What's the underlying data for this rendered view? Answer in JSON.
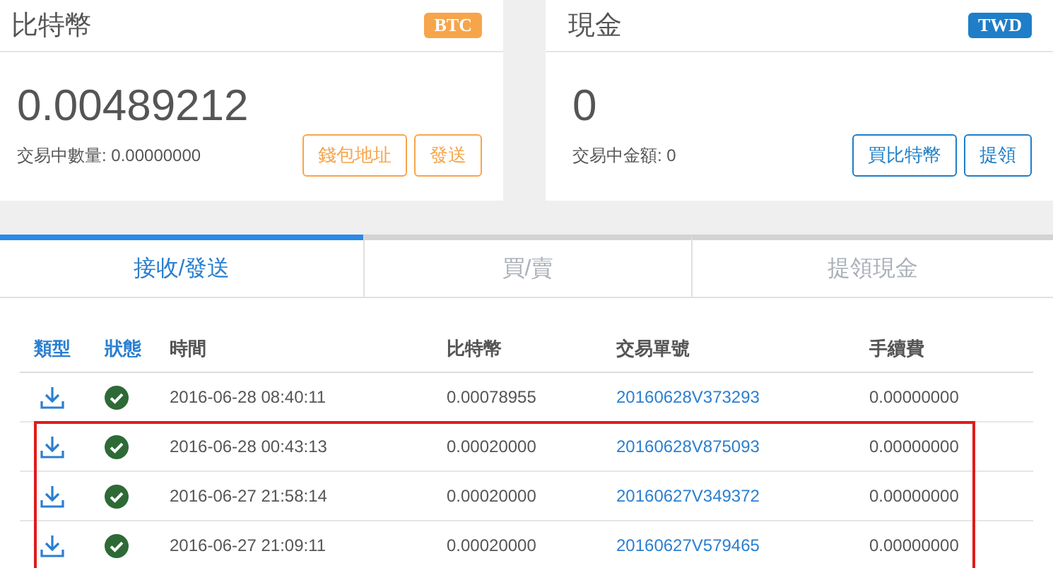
{
  "cards": [
    {
      "title": "比特幣",
      "badge": "BTC",
      "color": "#f7a54a",
      "amount": "0.00489212",
      "pending_label": "交易中數量:",
      "pending_value": "0.00000000",
      "buttons": [
        "錢包地址",
        "發送"
      ]
    },
    {
      "title": "現金",
      "badge": "TWD",
      "color": "#1f7ec7",
      "amount": "0",
      "pending_label": "交易中金額:",
      "pending_value": "0",
      "buttons": [
        "買比特幣",
        "提領"
      ]
    }
  ],
  "tabs": [
    {
      "label": "接收/發送",
      "selected": true
    },
    {
      "label": "買/賣",
      "selected": false
    },
    {
      "label": "提領現金",
      "selected": false
    }
  ],
  "table": {
    "columns": [
      "類型",
      "狀態",
      "時間",
      "比特幣",
      "交易單號",
      "手續費"
    ],
    "rows": [
      {
        "time": "2016-06-28 08:40:11",
        "btc": "0.00078955",
        "order": "20160628V373293",
        "fee": "0.00000000",
        "highlighted": false
      },
      {
        "time": "2016-06-28 00:43:13",
        "btc": "0.00020000",
        "order": "20160628V875093",
        "fee": "0.00000000",
        "highlighted": true
      },
      {
        "time": "2016-06-27 21:58:14",
        "btc": "0.00020000",
        "order": "20160627V349372",
        "fee": "0.00000000",
        "highlighted": true
      },
      {
        "time": "2016-06-27 21:09:11",
        "btc": "0.00020000",
        "order": "20160627V579465",
        "fee": "0.00000000",
        "highlighted": true
      }
    ]
  }
}
